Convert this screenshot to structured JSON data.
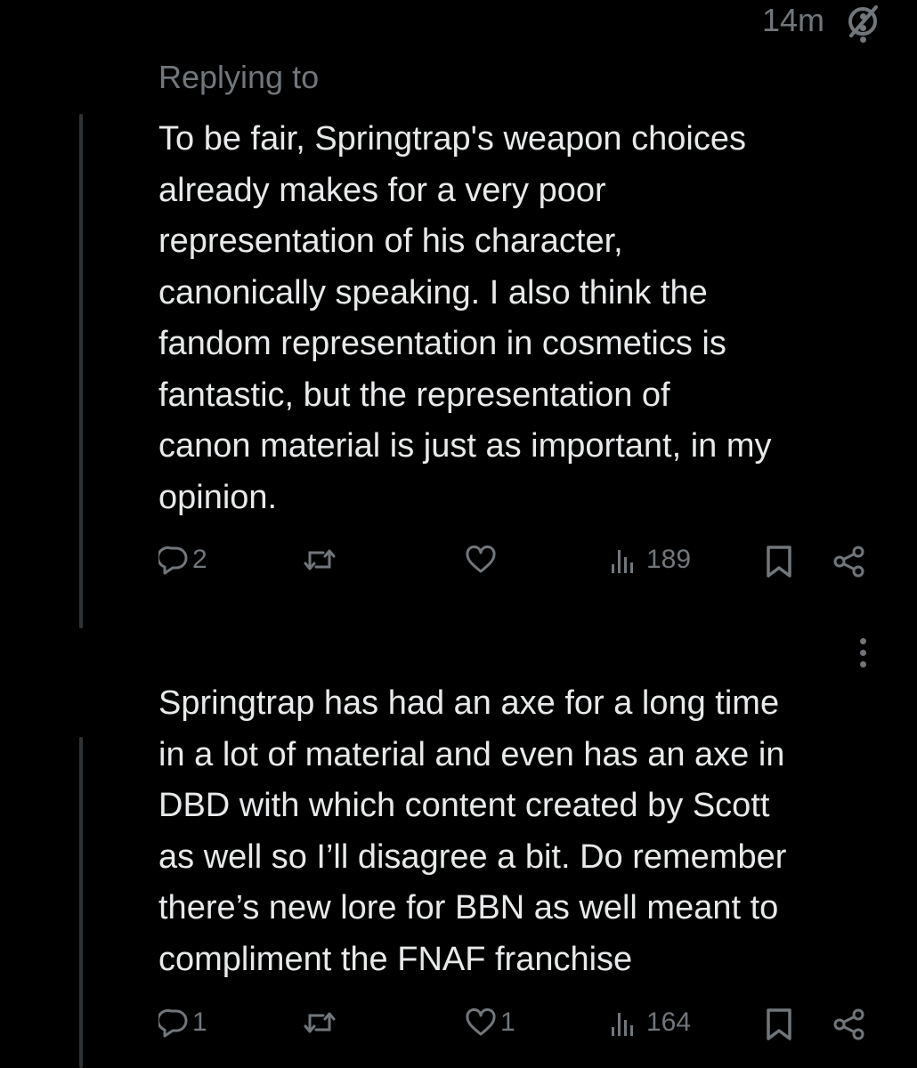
{
  "header": {
    "time": "14m",
    "grok_icon": "grok-slash-circle-icon",
    "more_icon": "more-vertical-icon"
  },
  "post1": {
    "replying_label": "Replying to",
    "text": "To be fair, Springtrap's weapon choices\nalready makes for a very poor\nrepresentation of his character,\ncanonically speaking. I also think the\nfandom representation in cosmetics is\nfantastic, but the representation of\ncanon material is just as important, in my\nopinion.",
    "replies": "2",
    "reposts": "",
    "likes": "",
    "views": "189"
  },
  "post2": {
    "text": "Springtrap has had an axe for a long time\nin a lot of material and even has an axe in\nDBD with which content created by Scott\nas well so I’ll disagree a bit. Do remember\nthere’s new lore for BBN as well meant to\ncompliment the FNAF franchise",
    "replies": "1",
    "reposts": "",
    "likes": "1",
    "views": "164"
  },
  "icons": {
    "reply": "reply-bubble-icon",
    "repost": "repost-arrows-icon",
    "like": "heart-icon",
    "views": "views-bars-icon",
    "bookmark": "bookmark-icon",
    "share": "share-icon"
  },
  "colors": {
    "background": "#000000",
    "text": "#e7e9ea",
    "muted": "#71767b",
    "thread_line": "#2f3336"
  }
}
